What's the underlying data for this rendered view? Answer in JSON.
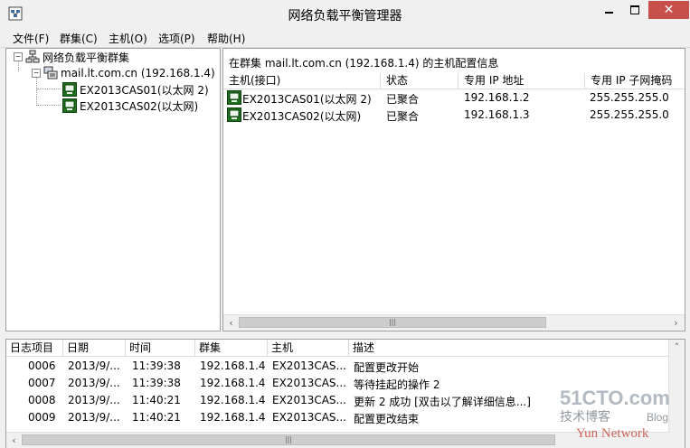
{
  "window": {
    "title": "网络负载平衡管理器"
  },
  "menu": [
    "文件(F)",
    "群集(C)",
    "主机(O)",
    "选项(P)",
    "帮助(H)"
  ],
  "tree": {
    "root": "网络负载平衡群集",
    "cluster": "mail.lt.com.cn (192.168.1.4)",
    "hosts": [
      "EX2013CAS01(以太网 2)",
      "EX2013CAS02(以太网)"
    ]
  },
  "host_panel": {
    "caption": "在群集 mail.lt.com.cn (192.168.1.4) 的主机配置信息",
    "columns": [
      "主机(接口)",
      "状态",
      "专用 IP 地址",
      "专用 IP 子网掩码"
    ],
    "rows": [
      [
        "EX2013CAS01(以太网 2)",
        "已聚合",
        "192.168.1.2",
        "255.255.255.0"
      ],
      [
        "EX2013CAS02(以太网)",
        "已聚合",
        "192.168.1.3",
        "255.255.255.0"
      ]
    ]
  },
  "log": {
    "columns": [
      "日志项目",
      "日期",
      "时间",
      "群集",
      "主机",
      "描述"
    ],
    "rows": [
      [
        "0006",
        "2013/9/...",
        "11:39:38",
        "192.168.1.4",
        "EX2013CAS...",
        "配置更改开始"
      ],
      [
        "0007",
        "2013/9/...",
        "11:39:38",
        "192.168.1.4",
        "EX2013CAS...",
        "等待挂起的操作 2"
      ],
      [
        "0008",
        "2013/9/...",
        "11:40:21",
        "192.168.1.4",
        "EX2013CAS...",
        "更新 2 成功 [双击以了解详细信息...]"
      ],
      [
        "0009",
        "2013/9/...",
        "11:40:21",
        "192.168.1.4",
        "EX2013CAS...",
        "配置更改结束"
      ]
    ]
  },
  "watermark": {
    "site": "51CTO.com",
    "line2": "技术博客",
    "line3": "Blog",
    "line4": "Yun Network"
  },
  "colors": {
    "close": "#c7504b",
    "window": "#f0f0f0",
    "border": "#a0a0a0"
  }
}
